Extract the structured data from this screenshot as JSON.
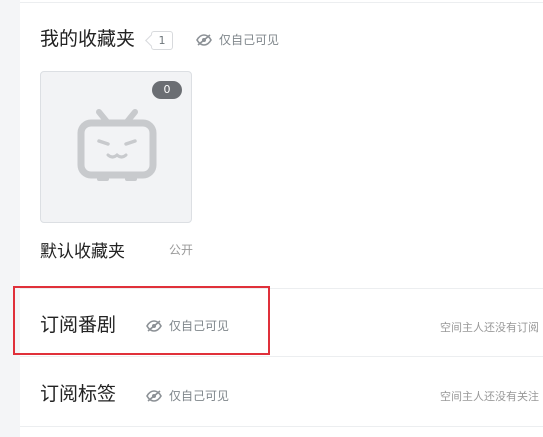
{
  "favorites_section": {
    "title": "我的收藏夹",
    "count": "1",
    "visibility_label": "仅自己可见",
    "folders": [
      {
        "name": "默认收藏夹",
        "item_count": "0",
        "visibility": "公开"
      }
    ]
  },
  "bangumi_section": {
    "title": "订阅番剧",
    "visibility_label": "仅自己可见",
    "empty_hint": "空间主人还没有订阅"
  },
  "tags_section": {
    "title": "订阅标签",
    "visibility_label": "仅自己可见",
    "empty_hint": "空间主人还没有关注"
  },
  "colors": {
    "highlight": "#e0303a",
    "muted_text": "#999999",
    "badge_bg": "#6b6e73"
  },
  "icons": {
    "visibility": "eye-slash-icon",
    "placeholder": "bilibili-tv-icon"
  }
}
